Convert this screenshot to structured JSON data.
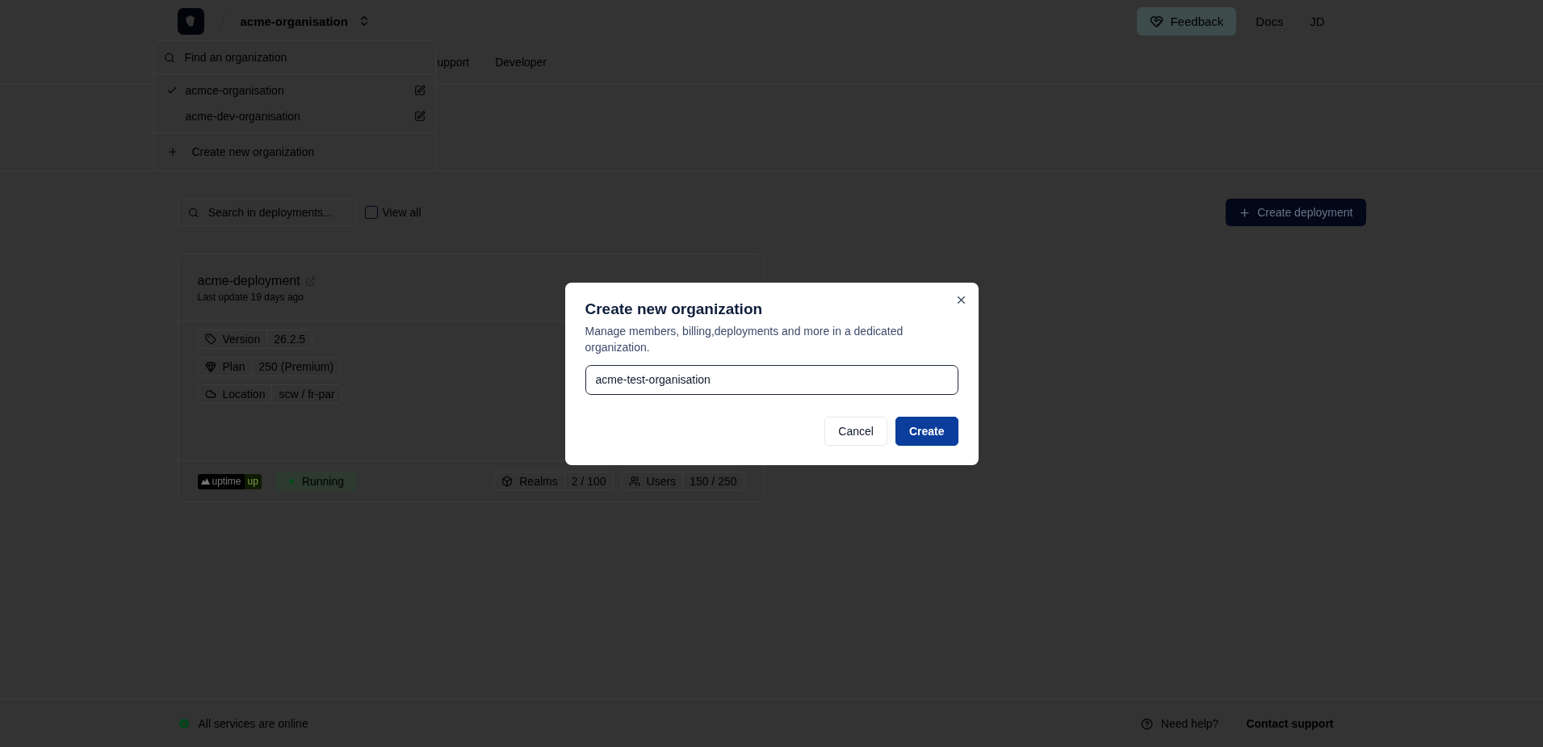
{
  "header": {
    "organization": "acme-organisation",
    "actions": [
      {
        "kind": "feedback",
        "label": "Feedback"
      },
      {
        "kind": "link",
        "label": "Docs"
      },
      {
        "kind": "avatar",
        "label": "JD"
      }
    ]
  },
  "nav_tabs": [
    {
      "label": "upport",
      "selected": false
    },
    {
      "label": "Developer",
      "selected": false
    }
  ],
  "org_menu": {
    "search_placeholder": "Find an organization",
    "items": [
      {
        "name": "acmce-organisation",
        "selected": true
      },
      {
        "name": "acme-dev-organisation",
        "selected": false
      }
    ],
    "create_label": "Create new organization"
  },
  "toolbar": {
    "search_placeholder": "Search in deployments...",
    "view_all": {
      "label": "View all",
      "checked": false
    },
    "create_button": "Create deployment"
  },
  "deployments": [
    {
      "name": "acme-deployment",
      "updated": "Last update 19 days ago",
      "details": [
        {
          "kind": "version",
          "label": "Version",
          "value": "26.2.5"
        },
        {
          "kind": "plan",
          "label": "Plan",
          "value": "250 (Premium)"
        },
        {
          "kind": "location",
          "label": "Location",
          "value": "scw / fr-par"
        }
      ],
      "uptime": {
        "label": "uptime",
        "status": "up"
      },
      "status": "Running",
      "counts": [
        {
          "kind": "realms",
          "label": "Realms",
          "value": "2 / 100"
        },
        {
          "kind": "users",
          "label": "Users",
          "value": "150 / 250"
        }
      ]
    }
  ],
  "dialog": {
    "title": "Create new organization",
    "description": "Manage members, billing,deployments and more in a dedicated organization.",
    "value": "acme-test-organisation",
    "buttons": [
      {
        "kind": "secondary",
        "label": "Cancel"
      },
      {
        "kind": "primary",
        "label": "Create"
      }
    ]
  },
  "footer": {
    "status": "All services are online",
    "help": "Need help?",
    "contact": "Contact support"
  }
}
